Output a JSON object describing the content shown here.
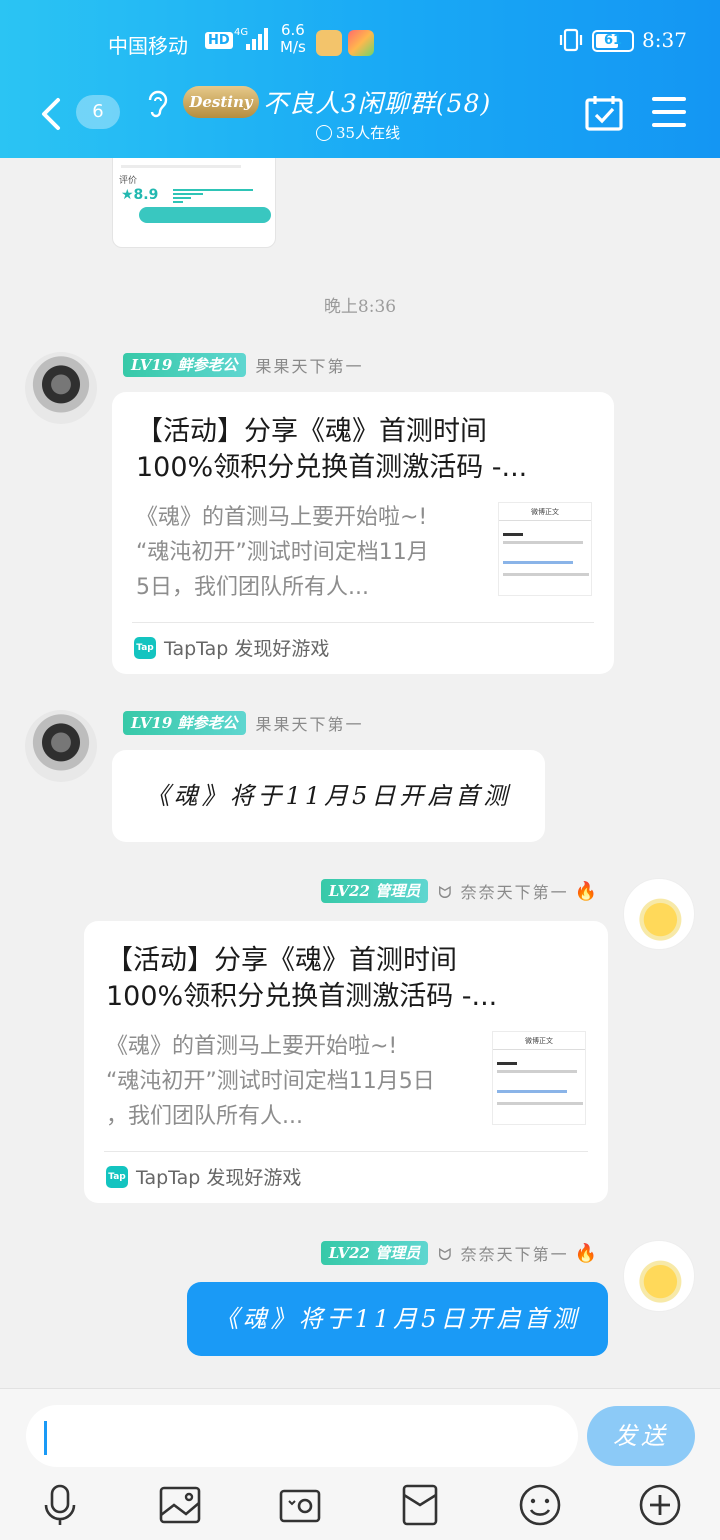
{
  "status_bar": {
    "carrier": "中国移动",
    "hd": "HD",
    "network": "4G",
    "speed_value": "6.6",
    "speed_unit": "M/s",
    "battery": "61",
    "time": "8:37"
  },
  "header": {
    "unread_count": "6",
    "group_logo_text": "Destiny",
    "group_title": "不良人3闲聊群(58)",
    "online_text": "35人在线"
  },
  "chat": {
    "prev_card": {
      "rating_label": "评价",
      "score": "★8.9"
    },
    "time_separator": "晚上8:36",
    "messages": [
      {
        "level": "LV19 鲜参老公",
        "nickname": "果果天下第一",
        "card_title": "【活动】分享《魂》首测时间\n100%领积分兑换首测激活码 -...",
        "card_desc": "《魂》的首测马上要开始啦~!\n“魂沌初开”测试时间定档11月\n5日，我们团队所有人...",
        "thumb_header": "微博正文",
        "source": "TapTap 发现好游戏"
      },
      {
        "level": "LV19 鲜参老公",
        "nickname": "果果天下第一",
        "text": "《魂》将于11月5日开启首测"
      },
      {
        "level": "LV22 管理员",
        "nickname": "ᗢ 奈奈天下第一",
        "card_title": "【活动】分享《魂》首测时间\n100%领积分兑换首测激活码 -...",
        "card_desc": "《魂》的首测马上要开始啦~!\n“魂沌初开”测试时间定档11月5日\n，我们团队所有人...",
        "thumb_header": "微博正文",
        "source": "TapTap 发现好游戏"
      },
      {
        "level": "LV22 管理员",
        "nickname": "ᗢ 奈奈天下第一",
        "text": "《魂》将于11月5日开启首测"
      }
    ]
  },
  "composer": {
    "placeholder": "",
    "send_label": "发送"
  },
  "tap_icon_text": "Tap",
  "fire_glyph": "🔥",
  "colors": {
    "accent": "#1a9af6",
    "header_start": "#2bc4f3",
    "level_badge": "#37c9a8"
  }
}
